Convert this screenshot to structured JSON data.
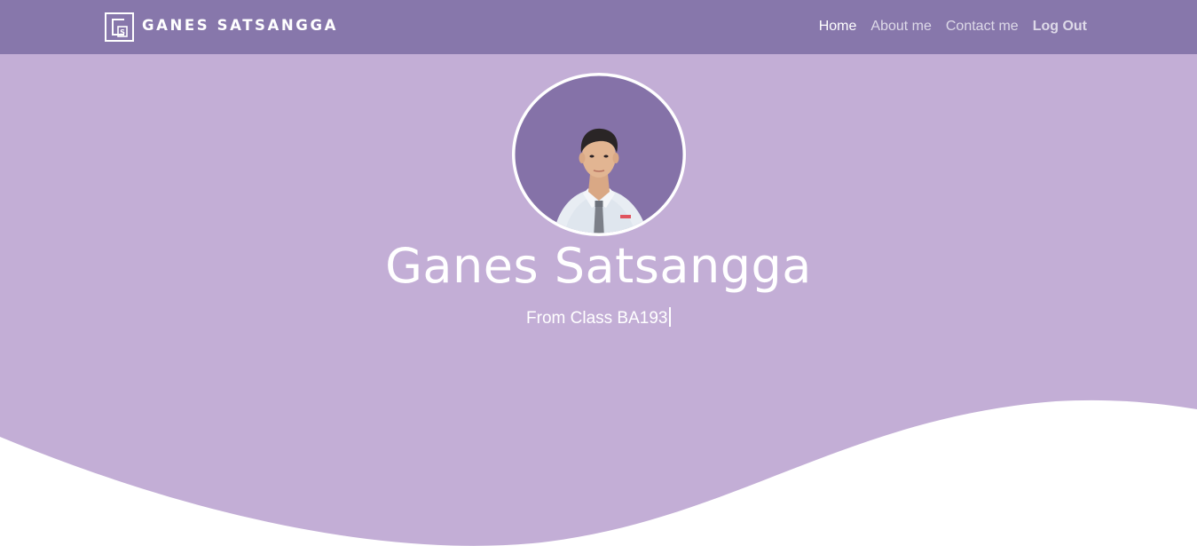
{
  "brand": {
    "name": "GANES SATSANGGA",
    "logo_letter": "G",
    "logo_small_letter": "S"
  },
  "nav": {
    "items": [
      {
        "label": "Home",
        "active": true
      },
      {
        "label": "About me",
        "active": false
      },
      {
        "label": "Contact me",
        "active": false
      },
      {
        "label": "Log Out",
        "active": false
      }
    ]
  },
  "hero": {
    "name": "Ganes Satsangga",
    "subtitle": "From Class BA193"
  },
  "colors": {
    "navbar": "#8777ab",
    "hero": "#c3aed6",
    "avatar_bg": "#8572a8",
    "white": "#ffffff"
  }
}
